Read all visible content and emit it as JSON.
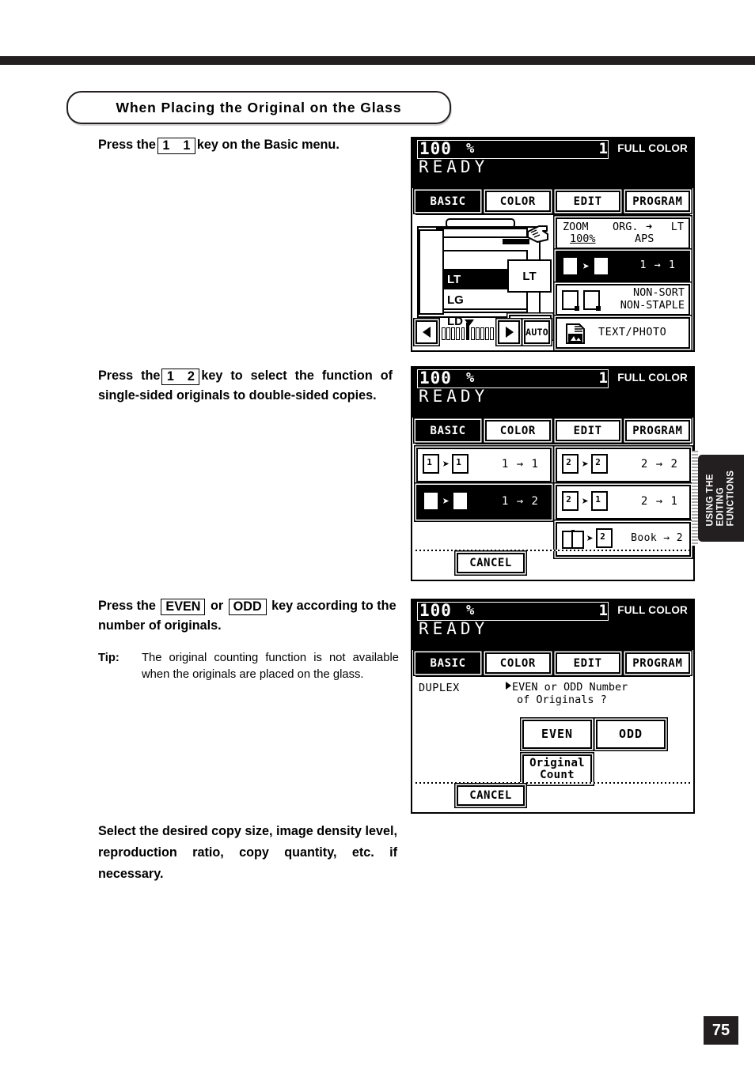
{
  "page": {
    "number": "75",
    "side_tab": "USING THE\nEDITING\nFUNCTIONS",
    "side_tab_line1": "USING THE",
    "side_tab_line2": "EDITING",
    "side_tab_line3": "FUNCTIONS"
  },
  "section": {
    "title": "When Placing the Original on the Glass"
  },
  "steps": [
    {
      "before": "Press the",
      "key": {
        "left": "1",
        "right": "1"
      },
      "after": "key on the Basic menu."
    },
    {
      "before": "Press the",
      "key": {
        "left": "1",
        "right": "2"
      },
      "after": "key to select the function of single-sided originals to double-sided copies."
    },
    {
      "before": "Press the",
      "key_even": "EVEN",
      "middle": "or",
      "key_odd": "ODD",
      "after": "key according to the number of originals.",
      "tip_label": "Tip:",
      "tip_body": "The original counting function is not available when the originals are placed on the glass."
    },
    {
      "text": "Select the desired copy size, image density level, reproduction ratio, copy quantity, etc. if necessary."
    }
  ],
  "lcd_common": {
    "ratio": "100",
    "percent": "%",
    "count": "1",
    "color_mode": "FULL COLOR",
    "status": "READY",
    "tabs": [
      {
        "label": "BASIC",
        "selected": true
      },
      {
        "label": "COLOR",
        "selected": false
      },
      {
        "label": "EDIT",
        "selected": false
      },
      {
        "label": "PROGRAM",
        "selected": false
      }
    ],
    "cancel": "CANCEL"
  },
  "panel1": {
    "paper_rows": [
      "",
      "LT",
      "LG",
      "LD"
    ],
    "selected_paper": "LT",
    "feed_label": "LT",
    "auto_label": "AUTO",
    "zoom_label": "ZOOM",
    "zoom_value": "100%",
    "org_label": "ORG.",
    "org_arrow": "➜",
    "org_size": "LT",
    "aps_label": "APS",
    "duplex_label": "1 → 1",
    "duplex_icon_from": "1",
    "duplex_icon_to": "1",
    "finish_line1": "NON-SORT",
    "finish_line2": "NON-STAPLE",
    "original_mode": "TEXT/PHOTO"
  },
  "panel2": {
    "options": [
      {
        "label": "1 → 1",
        "from": "1",
        "to": "1",
        "selected": false,
        "kind": "sheet"
      },
      {
        "label": "1 → 2",
        "from": "1",
        "to": "2",
        "selected": true,
        "kind": "sheet"
      },
      {
        "label": "2 → 2",
        "from": "2",
        "to": "2",
        "selected": false,
        "kind": "sheet"
      },
      {
        "label": "2 → 1",
        "from": "2",
        "to": "1",
        "selected": false,
        "kind": "sheet"
      },
      {
        "label": "Book → 2",
        "from": "book",
        "to": "2",
        "selected": false,
        "kind": "book"
      }
    ]
  },
  "panel3": {
    "mode_label": "DUPLEX",
    "question_line1": "EVEN or ODD Number",
    "question_line2": "of Originals ?",
    "even_button": "EVEN",
    "odd_button": "ODD",
    "original_count_line1": "Original",
    "original_count_line2": "Count"
  }
}
